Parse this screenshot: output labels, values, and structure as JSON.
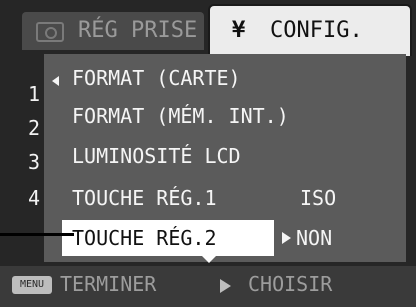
{
  "tabs": {
    "shooting": "RÉG PRISE",
    "config": "CONFIG.",
    "config_icon": "tools-icon",
    "shooting_icon": "camera-icon"
  },
  "menu": {
    "items": [
      {
        "num": "1",
        "label": "FORMAT  (CARTE)",
        "value": ""
      },
      {
        "num": "2",
        "label": "FORMAT  (MÉM. INT.)",
        "value": ""
      },
      {
        "num": "3",
        "label": "LUMINOSITÉ LCD",
        "value": ""
      },
      {
        "num": "4",
        "label": "TOUCHE RÉG.1",
        "value": "ISO"
      },
      {
        "num": "",
        "label": "TOUCHE RÉG.2",
        "value": "NON"
      }
    ]
  },
  "footer": {
    "menu_key": "MENU",
    "exit": "TERMINER",
    "choose": "CHOISIR"
  }
}
